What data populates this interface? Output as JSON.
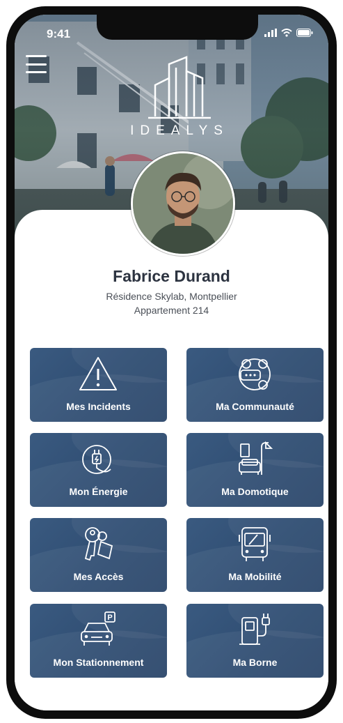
{
  "status_bar": {
    "time": "9:41"
  },
  "app": {
    "logo_text": "IDEALYS"
  },
  "profile": {
    "name": "Fabrice Durand",
    "residence": "Résidence Skylab, Montpellier",
    "apartment": "Appartement 214"
  },
  "tiles": [
    {
      "label": "Mes Incidents",
      "icon": "warning-icon"
    },
    {
      "label": "Ma Communauté",
      "icon": "community-icon"
    },
    {
      "label": "Mon Énergie",
      "icon": "plug-icon"
    },
    {
      "label": "Ma Domotique",
      "icon": "smart-home-icon"
    },
    {
      "label": "Mes Accès",
      "icon": "keys-icon"
    },
    {
      "label": "Ma Mobilité",
      "icon": "bus-icon"
    },
    {
      "label": "Mon Stationnement",
      "icon": "parking-car-icon"
    },
    {
      "label": "Ma Borne",
      "icon": "charging-station-icon"
    }
  ],
  "colors": {
    "tile_bg": "#2f4d72",
    "name_text": "#2c3340"
  }
}
